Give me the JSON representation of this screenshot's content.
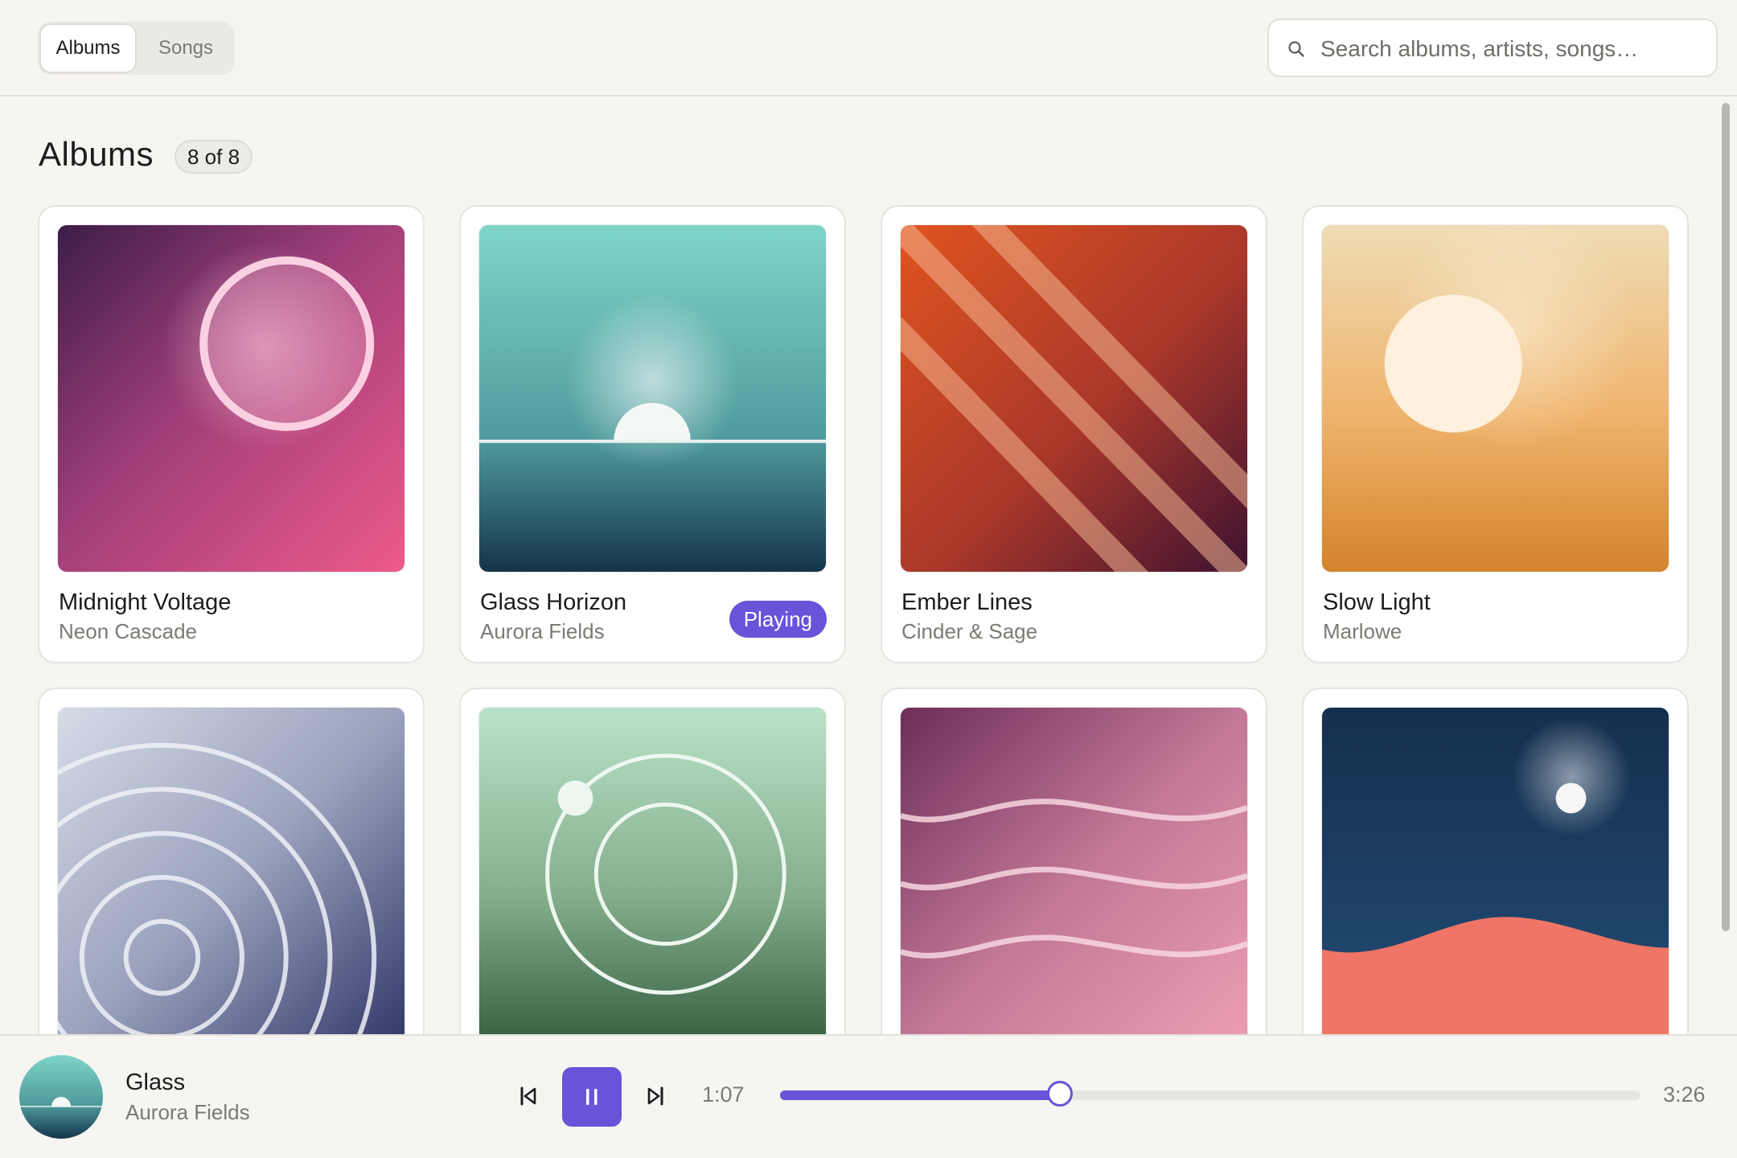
{
  "header": {
    "tabs": [
      {
        "label": "Albums",
        "active": true
      },
      {
        "label": "Songs",
        "active": false
      }
    ],
    "search": {
      "placeholder": "Search albums, artists, songs…",
      "value": "",
      "icon": "search-icon"
    }
  },
  "main": {
    "title": "Albums",
    "count": "8 of 8",
    "albums": [
      {
        "title": "Midnight Voltage",
        "artist": "Neon Cascade"
      },
      {
        "title": "Glass Horizon",
        "artist": "Aurora Fields",
        "badge": "Playing"
      },
      {
        "title": "Ember Lines",
        "artist": "Cinder & Sage"
      },
      {
        "title": "Slow Light",
        "artist": "Marlowe"
      }
    ]
  },
  "player": {
    "title": "Glass",
    "artist": "Aurora Fields",
    "elapsed": "1:07",
    "total": "3:26",
    "progress_fraction": 0.325,
    "accent": "#6754d9",
    "controls": [
      "skip-back-icon",
      "pause-icon",
      "skip-forward-icon"
    ]
  }
}
